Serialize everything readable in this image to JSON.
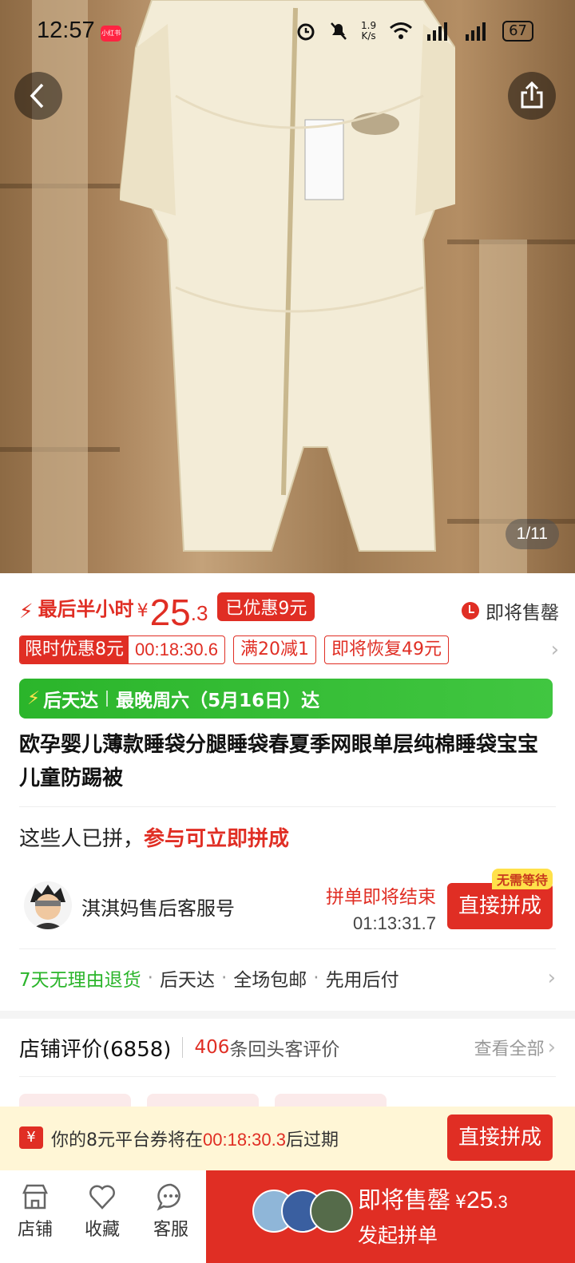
{
  "status_bar": {
    "time": "12:57",
    "app_badge": "小红书",
    "net_speed_value": "1.9",
    "net_speed_unit": "K/s",
    "battery": "67"
  },
  "gallery": {
    "counter": "1/11"
  },
  "price": {
    "urgency_label": "最后半小时",
    "currency": "¥",
    "amount_int": "25",
    "amount_dec": ".3",
    "discount_tag": "已优惠9元",
    "stock_status": "即将售罄"
  },
  "promotions": {
    "limited_label": "限时优惠8元",
    "countdown": "00:18:30.6",
    "items": [
      "满20减1",
      "即将恢复49元"
    ]
  },
  "delivery": {
    "brand": "后天达",
    "eta": "最晚周六（5月16日）达"
  },
  "product": {
    "title": "欧孕婴儿薄款睡袋分腿睡袋春夏季网眼单层纯棉睡袋宝宝儿童防踢被"
  },
  "group_buy": {
    "heading": "这些人已拼，",
    "heading_highlight": "参与可立即拼成",
    "user_name": "淇淇妈售后客服号",
    "ending_label": "拼单即将结束",
    "ending_countdown": "01:13:31.7",
    "join_label": "直接拼成",
    "no_wait_badge": "无需等待"
  },
  "guarantees": {
    "return_policy": "7天无理由退货",
    "items": [
      "后天达",
      "全场包邮",
      "先用后付"
    ]
  },
  "reviews": {
    "label": "店铺评价(6858)",
    "repeat_count": "406",
    "repeat_text": "条回头客评价",
    "view_all": "查看全部"
  },
  "coupon": {
    "icon_glyph": "¥",
    "prefix": "你的8元平台券将在",
    "countdown": "00:18:30.3",
    "suffix": "后过期",
    "button": "直接拼成"
  },
  "bottom_bar": {
    "store": "店铺",
    "favorite": "收藏",
    "service": "客服",
    "buy_status": "即将售罄",
    "buy_currency": "¥",
    "buy_price_int": "25",
    "buy_price_dec": ".3",
    "buy_action": "发起拼单"
  },
  "colors": {
    "accent_red": "#e02e24",
    "delivery_green": "#2bb52b",
    "coupon_bg": "#fff6d6"
  }
}
